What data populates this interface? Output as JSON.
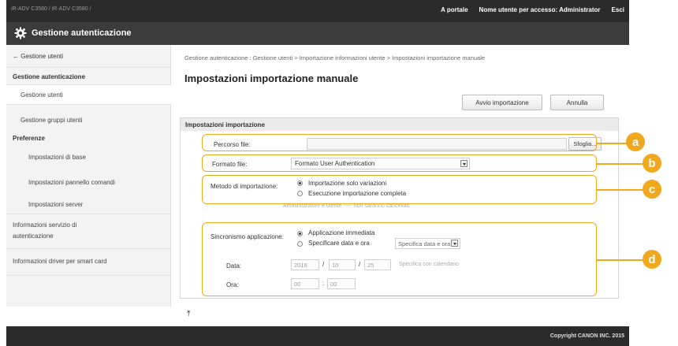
{
  "header": {
    "device": "iR-ADV C3580 / iR-ADV C3580 /",
    "portal_link": "A portale",
    "user_label": "Nome utente per accesso:",
    "user_name": "Administrator",
    "logout": "Esci"
  },
  "titlebar": {
    "title": "Gestione autenticazione",
    "icon": "gear-icon"
  },
  "sidebar": {
    "back": "← Gestione utenti",
    "section1": "Gestione autenticazione",
    "item_users": "Gestione utenti",
    "item_groups": "Gestione gruppi utenti",
    "section2": "Preferenze",
    "item_basic": "Impostazioni di base",
    "item_panel": "Impostazioni pannello comandi",
    "item_server": "Impostazioni server",
    "item_service_1": "Informazioni servizio di",
    "item_service_2": "autenticazione",
    "item_driver": "Informazioni driver per smart card"
  },
  "main": {
    "breadcrumb": "Gestione autenticazione : Gestione utenti > Importazione informazioni utente > Impostazioni importazione manuale",
    "title": "Impostazioni importazione manuale",
    "btn_start": "Avvio importazione",
    "btn_cancel": "Annulla",
    "section_title": "Impostazioni importazione",
    "file_path_label": "Percorso file:",
    "file_path_value": "",
    "browse_btn": "Sfoglia...",
    "format_label": "Formato file:",
    "format_value": "Formato User Authentication",
    "method_label": "Metodo di importazione:",
    "method_opt1": "Importazione solo variazioni",
    "method_opt2": "Esecuzione importazione completa",
    "method_note": "Amministratore e utente ----- non saranno cancellati.",
    "sync_label": "Sincronismo applicazione:",
    "sync_opt1": "Applicazione immediata",
    "sync_opt2": "Specificare data e ora",
    "sync_select": "Specifica data e ora",
    "date_label": "Data:",
    "date_year": "2016",
    "date_month": "10",
    "date_day": "25",
    "date_sep1": "/",
    "date_sep2": "/",
    "calendar_link": "Specifica con calendario",
    "time_label": "Ora:",
    "time_h": "00",
    "time_sep": ":",
    "time_m": "00"
  },
  "callouts": {
    "a": "a",
    "b": "b",
    "c": "c",
    "d": "d"
  },
  "footer": {
    "copyright": "Copyright CANON INC. 2015"
  },
  "colors": {
    "callout": "#f0a81e",
    "header_bg": "#2b2b2b"
  }
}
